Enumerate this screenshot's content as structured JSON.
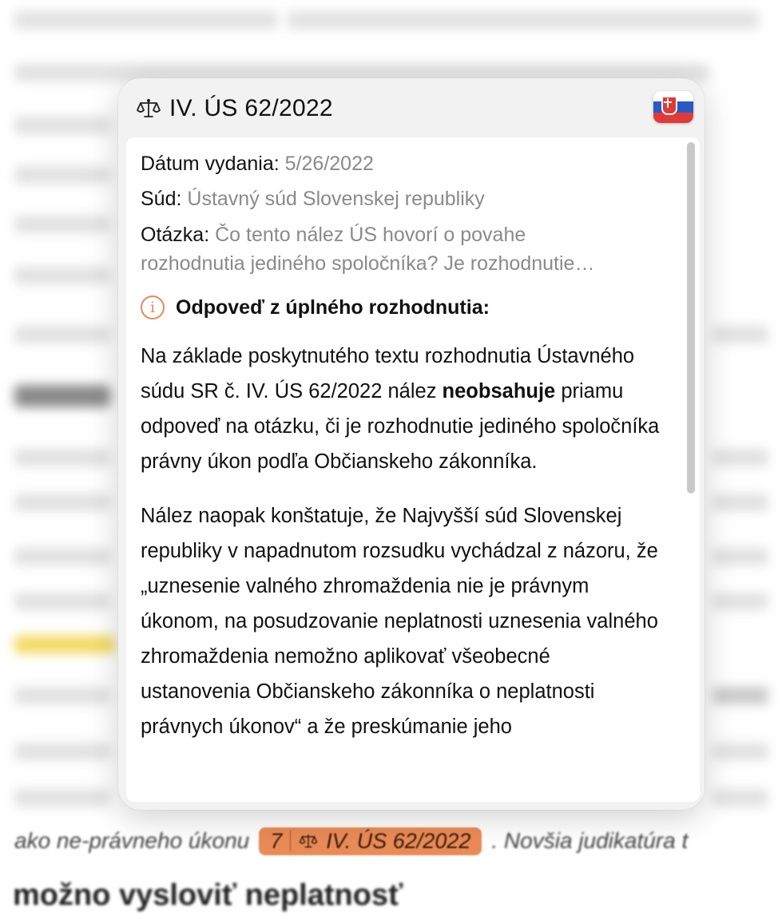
{
  "popover": {
    "case_title": "IV. ÚS 62/2022",
    "scale_icon": "scale-icon",
    "flag_icon": "slovakia-flag-icon",
    "date_label": "Dátum vydania:",
    "date_value": "5/26/2022",
    "court_label": "Súd:",
    "court_value": "Ústavný súd Slovenskej republiky",
    "question_label": "Otázka:",
    "question_line1": "Čo tento nález ÚS hovorí o povahe",
    "question_line2": "rozhodnutia jediného spoločníka? Je rozhodnutie…",
    "answer_heading": "Odpoveď z úplného rozhodnutia:",
    "para1_a": "Na základe poskytnutého textu rozhodnutia Ústavného súdu SR č. IV. ÚS 62/2022 nález ",
    "para1_bold": "neobsahuje",
    "para1_b": " priamu odpoveď na otázku, či je rozhodnutie jediného spoločníka právny úkon podľa Občianskeho zákonníka.",
    "para2": "Nález naopak konštatuje, že Najvyšší súd Slovenskej republiky v napadnutom rozsudku vychádzal z názoru, že „uznesenie valného zhromaždenia nie je právnym úkonom, na posudzovanie neplatnosti uznesenia valného zhromaždenia nemožno aplikovať všeobecné ustanovenia Občianskeho zákonníka o neplatnosti právnych úkonov“ a že preskúmanie jeho"
  },
  "background": {
    "bottom_text_before": "ako ne-právneho úkonu",
    "citation_number": "7",
    "citation_case": "IV. ÚS 62/2022",
    "bottom_text_after": ". Novšia judikatúra t",
    "heading_partial": "možno vysloviť neplatnosť"
  }
}
